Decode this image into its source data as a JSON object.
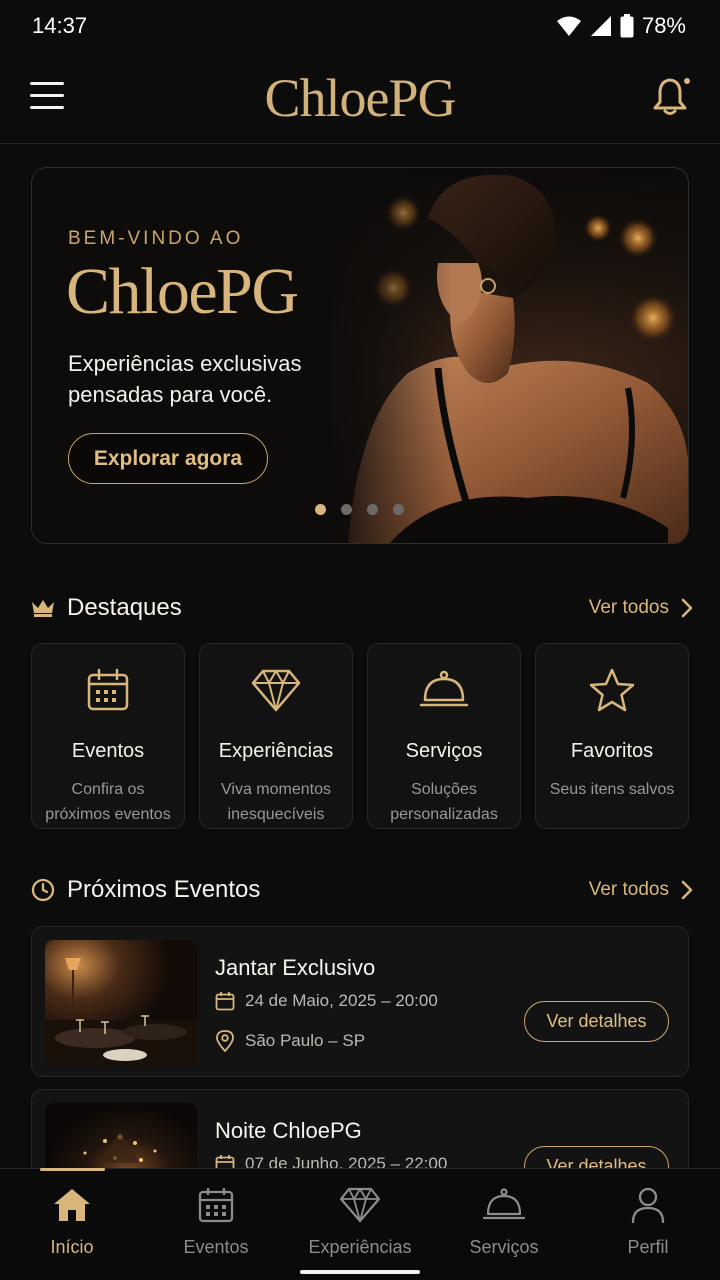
{
  "status_bar": {
    "time": "14:37",
    "battery": "78%"
  },
  "header": {
    "logo": "ChloePG"
  },
  "hero": {
    "eyebrow": "BEM-VINDO AO",
    "title": "ChloePG",
    "subtitle": "Experiências exclusivas pensadas para você.",
    "cta": "Explorar agora",
    "slides_total": 4,
    "slide_active": 1
  },
  "highlights": {
    "title": "Destaques",
    "see_all": "Ver todos",
    "items": [
      {
        "icon": "calendar-icon",
        "title": "Eventos",
        "desc": "Confira os próximos eventos"
      },
      {
        "icon": "diamond-icon",
        "title": "Experiências",
        "desc": "Viva momentos inesquecíveis"
      },
      {
        "icon": "cloche-icon",
        "title": "Serviços",
        "desc": "Soluções personalizadas"
      },
      {
        "icon": "star-icon",
        "title": "Favoritos",
        "desc": "Seus itens salvos"
      }
    ]
  },
  "events": {
    "title": "Próximos Eventos",
    "see_all": "Ver todos",
    "items": [
      {
        "title": "Jantar Exclusivo",
        "date": "24 de Maio, 2025 – 20:00",
        "location": "São Paulo – SP",
        "button": "Ver detalhes"
      },
      {
        "title": "Noite ChloePG",
        "date": "07 de Junho, 2025 – 22:00",
        "location": "",
        "button": "Ver detalhes"
      }
    ]
  },
  "bottom_nav": {
    "items": [
      {
        "label": "Início",
        "icon": "home-icon",
        "active": true
      },
      {
        "label": "Eventos",
        "icon": "calendar-icon",
        "active": false
      },
      {
        "label": "Experiências",
        "icon": "diamond-icon",
        "active": false
      },
      {
        "label": "Serviços",
        "icon": "cloche-icon",
        "active": false
      },
      {
        "label": "Perfil",
        "icon": "user-icon",
        "active": false
      }
    ]
  },
  "colors": {
    "accent": "#d9b77c",
    "background": "#0c0c0c",
    "card": "#131313",
    "muted_text": "#9b9893"
  }
}
